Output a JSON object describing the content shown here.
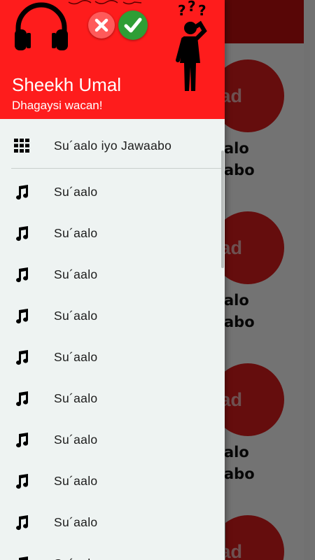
{
  "background": {
    "cards": [
      {
        "circle_text": "had",
        "line1": "alo",
        "line2": "abo"
      },
      {
        "circle_text": "had",
        "line1": "alo",
        "line2": "abo"
      },
      {
        "circle_text": "had",
        "line1": "alo",
        "line2": "abo"
      },
      {
        "circle_text": "had"
      }
    ]
  },
  "drawer": {
    "header": {
      "title": "Sheekh Umal",
      "subtitle": "Dhagaysi wacan!"
    },
    "grid_item": {
      "label": "Su´aalo iyo Jawaabo",
      "icon": "grid-icon"
    },
    "items": [
      {
        "label": "Su´aalo",
        "icon": "music-note-icon"
      },
      {
        "label": "Su´aalo",
        "icon": "music-note-icon"
      },
      {
        "label": "Su´aalo",
        "icon": "music-note-icon"
      },
      {
        "label": "Su´aalo",
        "icon": "music-note-icon"
      },
      {
        "label": "Su´aalo",
        "icon": "music-note-icon"
      },
      {
        "label": "Su´aalo",
        "icon": "music-note-icon"
      },
      {
        "label": "Su´aalo",
        "icon": "music-note-icon"
      },
      {
        "label": "Su´aalo",
        "icon": "music-note-icon"
      },
      {
        "label": "Su´aalo",
        "icon": "music-note-icon"
      },
      {
        "label": "Su´aalo",
        "icon": "music-note-icon"
      }
    ]
  },
  "colors": {
    "header": "#fe1c1c",
    "toolbar": "#c40f0f",
    "drawer_bg": "#eef3f2",
    "close_button": "#ff5a5a",
    "check_button": "#2e9e35"
  }
}
